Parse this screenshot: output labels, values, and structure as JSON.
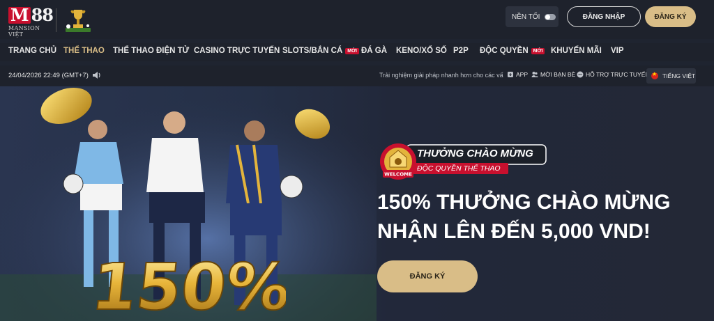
{
  "header": {
    "logo_text": "M88",
    "logo_sub": "MANSION VIỆT",
    "theme_toggle_label": "NỀN TỐI",
    "login_label": "ĐĂNG NHẬP",
    "register_label": "ĐĂNG KÝ"
  },
  "nav": {
    "items": [
      {
        "label": "TRANG CHỦ"
      },
      {
        "label": "THỂ THAO"
      },
      {
        "label": "THỂ THAO ĐIỆN TỬ"
      },
      {
        "label": "CASINO TRỰC TUYẾN"
      },
      {
        "label": "SLOTS/BẮN CÁ",
        "badge": "MỚI"
      },
      {
        "label": "ĐÁ GÀ"
      },
      {
        "label": "KENO/XỔ SỐ"
      },
      {
        "label": "P2P"
      },
      {
        "label": "ĐỘC QUYỀN",
        "badge": "MỚI"
      },
      {
        "label": "KHUYẾN MÃI"
      },
      {
        "label": "VIP"
      }
    ],
    "active_index": 1
  },
  "infobar": {
    "datetime": "24/04/2026 22:49 (GMT+7)",
    "marquee": "Trải nghiệm giải pháp nhanh hơn cho các vấn",
    "app_label": "APP",
    "refer_label": "MỜI BẠN BÈ",
    "support_label": "HỖ TRỢ TRỰC TUYẾN",
    "language_label": "TIẾNG VIỆT"
  },
  "hero": {
    "badge_title": "THƯỞNG CHÀO MỪNG",
    "badge_sub": "ĐỘC QUYỀN THỂ THAO",
    "badge_stamp": "WELCOME",
    "headline_line1": "150% THƯỞNG CHÀO MỪNG",
    "headline_line2": "NHẬN LÊN ĐẾN 5,000 VND!",
    "promo_number": "150%",
    "cta_label": "ĐĂNG KÝ"
  },
  "colors": {
    "accent_gold": "#d9bd87",
    "badge_red": "#c8102e",
    "header_bg": "#1e222c"
  }
}
